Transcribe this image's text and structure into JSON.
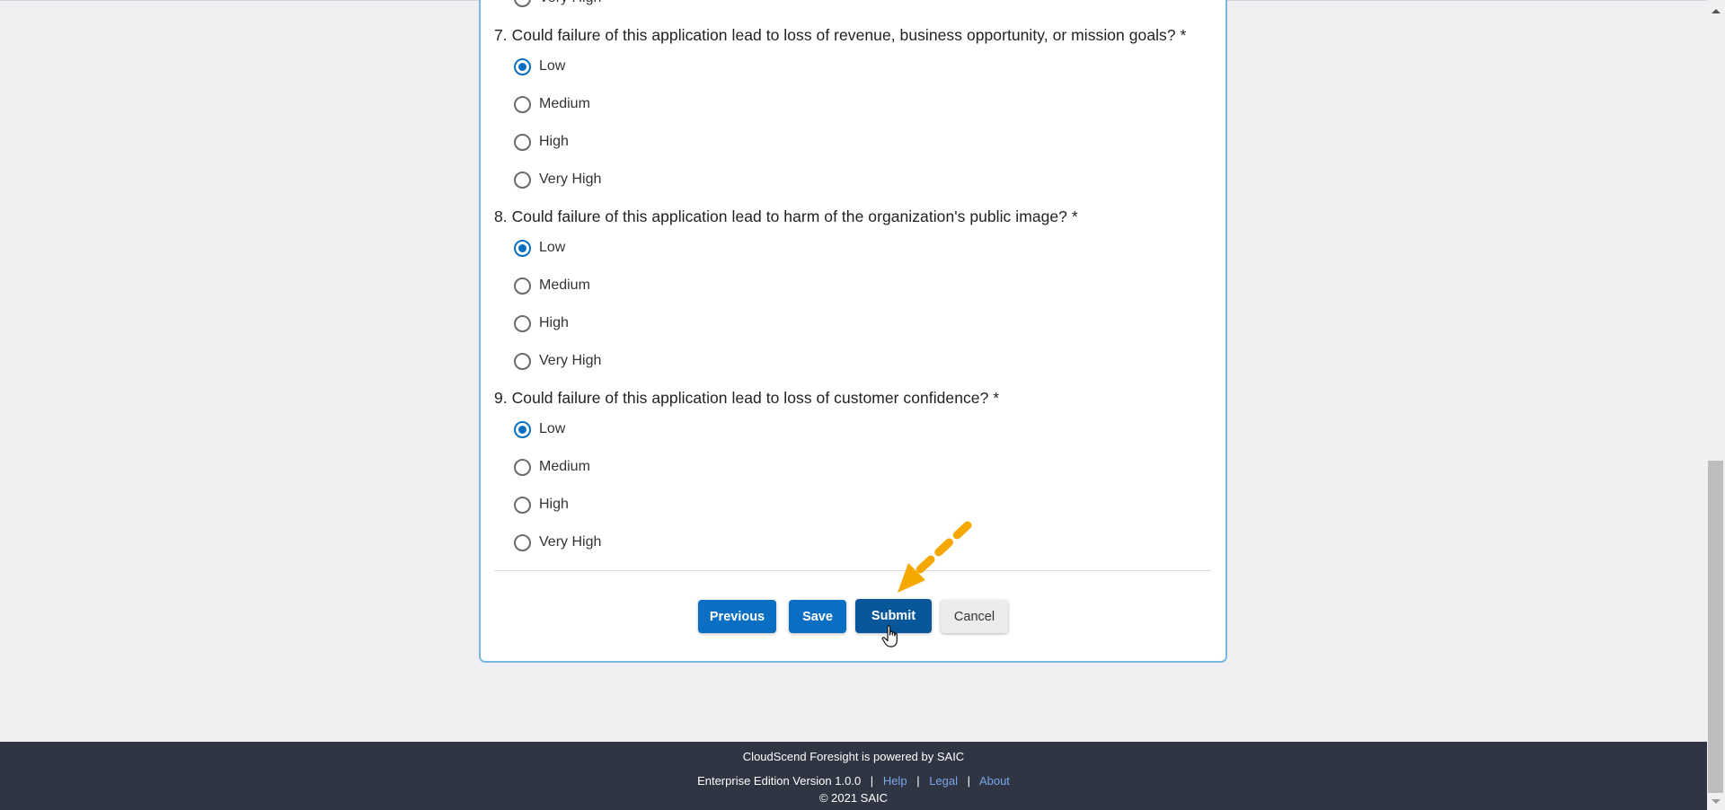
{
  "previous_question_tail": {
    "option_label": "Very High"
  },
  "questions": [
    {
      "title": "7. Could failure of this application lead to loss of revenue, business opportunity, or mission goals? *",
      "selected": "Low",
      "options": [
        "Low",
        "Medium",
        "High",
        "Very High"
      ]
    },
    {
      "title": "8. Could failure of this application lead to harm of the organization's public image? *",
      "selected": "Low",
      "options": [
        "Low",
        "Medium",
        "High",
        "Very High"
      ]
    },
    {
      "title": "9. Could failure of this application lead to loss of customer confidence? *",
      "selected": "Low",
      "options": [
        "Low",
        "Medium",
        "High",
        "Very High"
      ]
    }
  ],
  "actions": {
    "previous": "Previous",
    "save": "Save",
    "submit": "Submit",
    "cancel": "Cancel"
  },
  "footer": {
    "powered_by": "CloudScend Foresight is powered by SAIC",
    "edition": "Enterprise Edition Version 1.0.0",
    "separator": "|",
    "links": [
      "Help",
      "Legal",
      "About"
    ],
    "copyright": "© 2021 SAIC"
  },
  "colors": {
    "primary": "#0a6fc2",
    "primary_active": "#08579a",
    "card_border": "#7ab8e0",
    "footer_bg": "#2f3542",
    "footer_link": "#79a6ec",
    "annotation_arrow": "#f5a800"
  },
  "annotation": {
    "type": "dashed-arrow",
    "points_to": "Submit"
  }
}
